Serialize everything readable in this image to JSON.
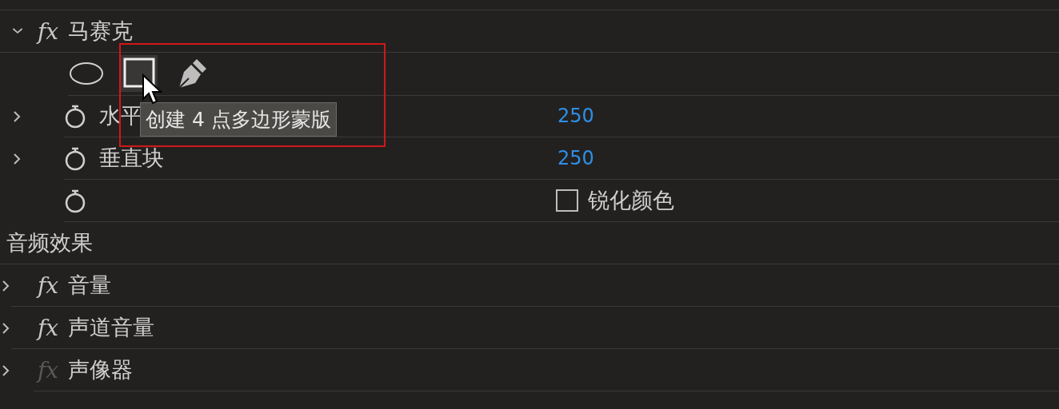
{
  "video_effect": {
    "badge": "fx",
    "name": "马赛克",
    "expanded": true,
    "enabled": true,
    "mask_tools": [
      {
        "kind": "ellipse",
        "selected": false
      },
      {
        "kind": "rectangle",
        "selected": true
      },
      {
        "kind": "pen",
        "selected": false
      }
    ],
    "properties": [
      {
        "kind": "value",
        "name": "水平",
        "expanded": false,
        "value": "250"
      },
      {
        "kind": "value",
        "name": "垂直块",
        "expanded": false,
        "value": "250"
      },
      {
        "kind": "checkbox",
        "label": "锐化颜色",
        "checked": false
      }
    ]
  },
  "tooltip": "创建 4 点多边形蒙版",
  "audio_effects": {
    "title": "音频效果",
    "effects": [
      {
        "badge": "fx",
        "name": "音量",
        "expanded": false,
        "enabled": true
      },
      {
        "badge": "fx",
        "name": "声道音量",
        "expanded": false,
        "enabled": true
      },
      {
        "badge": "fx",
        "name": "声像器",
        "expanded": false,
        "enabled": false
      }
    ]
  }
}
